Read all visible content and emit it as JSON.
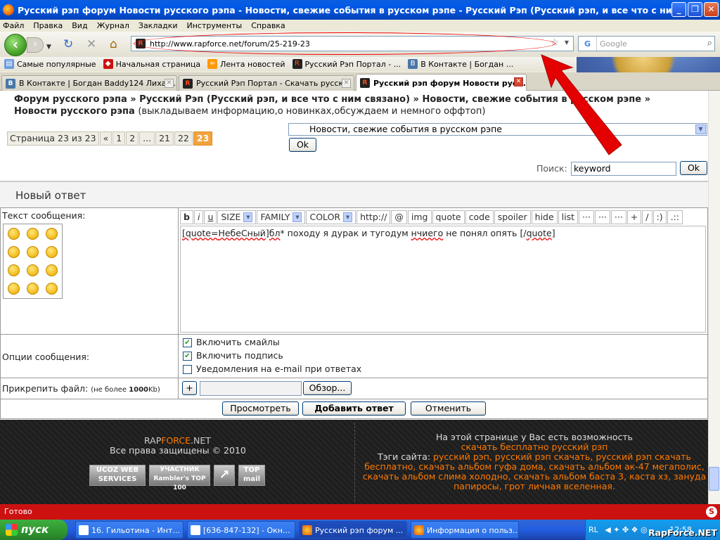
{
  "window": {
    "title": "Русский рэп форум Новости русского рэпа - Новости, свежие события в русском рэпе - Русский Рэп (Русский рэп, и все что с ним связано) - ..."
  },
  "menu": [
    "Файл",
    "Правка",
    "Вид",
    "Журнал",
    "Закладки",
    "Инструменты",
    "Справка"
  ],
  "nav": {
    "url": "http://www.rapforce.net/forum/25-219-23",
    "search_placeholder": "Google"
  },
  "bookmarks": [
    "Самые популярные",
    "Начальная страница",
    "Лента новостей",
    "Русский Рэп Портал - ...",
    "В Контакте | Богдан ..."
  ],
  "tabs": [
    "В Контакте | Богдан Baddy124 Лихач...",
    "Русский Рэп Портал - Скачать русск...",
    "Русский рэп форум Новости рус..."
  ],
  "breadcrumb": {
    "path": "Форум русского рэпа » Русский Рэп (Русский рэп, и все что с ним связано) » Новости, свежие события в русском рэпе »",
    "current": "Новости русского рэпа",
    "desc": "(выкладываем информацию,о новинках,обсуждаем и немного оффтоп)"
  },
  "pager": {
    "info": "Страница 23 из 23",
    "prev": "«",
    "pages": [
      "1",
      "2",
      "...",
      "21",
      "22"
    ],
    "current": "23"
  },
  "forum_select": {
    "value": "Новости, свежие события в русском рэпе",
    "ok": "Ok"
  },
  "search": {
    "label": "Поиск:",
    "value": "keyword",
    "ok": "Ok"
  },
  "reply": {
    "heading": "Новый ответ",
    "text_label": "Текст сообщения:",
    "toolbar": [
      "b",
      "i",
      "u"
    ],
    "selects": [
      "SIZE",
      "FAMILY",
      "COLOR"
    ],
    "toolbar2": [
      "http://",
      "@",
      "img",
      "quote",
      "code",
      "spoiler",
      "hide",
      "list",
      "···",
      "···",
      "···",
      "+",
      "/",
      ":)",
      ".::"
    ],
    "message": {
      "a": "[quote=",
      "b": "НебеСный",
      "c": "]",
      "d": "бл",
      "e": "* походу я дурак и тугодум ",
      "f": "нчиего",
      "g": " не понял опять [/",
      "h": "quote",
      "i": "]"
    },
    "options_label": "Опции сообщения:",
    "options": [
      "Включить смайлы",
      "Включить подпись",
      "Уведомления на e-mail при ответах"
    ],
    "attach_label": "Прикрепить файл:",
    "attach_note_a": "(не более ",
    "attach_note_b": "1000",
    "attach_note_c": "Kb)",
    "attach_plus": "+",
    "browse": "Обзор...",
    "buttons": [
      "Просмотреть",
      "Добавить ответ",
      "Отменить"
    ]
  },
  "footer": {
    "brand_a": "RAP",
    "brand_b": "FORCE",
    "brand_c": ".NET",
    "copyright": "Все права защищены © 2010",
    "badges": [
      "UCOZ WEB SERVICES",
      "УЧАСТНИК Rambler's TOP 100",
      "↗",
      "TOP mail"
    ],
    "right_title": "На этой странице у Вас есть возможность",
    "right_link": "скачать бесплатно русский рэп",
    "tags_label": "Тэги сайта: ",
    "tags": "русский рэп, русский рэп скачать, русский рэп скачать бесплатно, скачать альбом гуфа дома, скачать альбом ак-47 мегаполис, скачать альбом слима холодно, скачать альбом баста 3, каста хз, зануда папиросы, грот личная вселенная."
  },
  "status": "Готово",
  "taskbar": {
    "start": "пуск",
    "tasks": [
      "16. Гильотина - Инт...",
      "[636-847-132] - Окн...",
      "Русский рэп форум ...",
      "Информация о польз..."
    ],
    "lang": "RL",
    "clock": "12:58"
  },
  "watermark": "RapForce.NET",
  "colors": {
    "accent": "#f2a23e",
    "footer_link": "#ff7a00",
    "statusbar": "#cc1111"
  }
}
